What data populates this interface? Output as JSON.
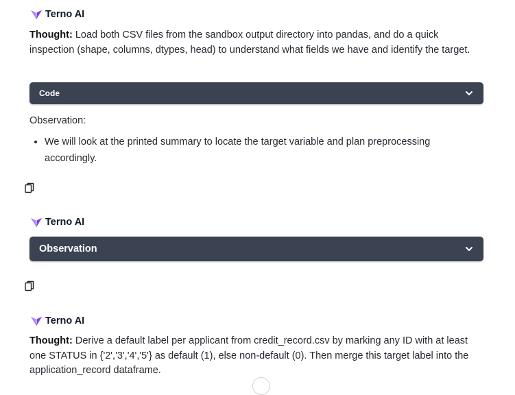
{
  "colors": {
    "bar_bg": "#3b4352",
    "logo": "#8b5cf6",
    "text": "#24292f"
  },
  "messages": [
    {
      "author": "Terno AI",
      "thought_label": "Thought:",
      "thought_text": "Load both CSV files from the sandbox output directory into pandas, and do a quick inspection (shape, columns, dtypes, head) to understand what fields we have and identify the target.",
      "code_label": "Code",
      "observation_label": "Observation:",
      "observation_items": [
        "We will look at the printed summary to locate the target variable and plan preprocessing accordingly."
      ]
    },
    {
      "author": "Terno AI",
      "panel_label": "Observation"
    },
    {
      "author": "Terno AI",
      "thought_label": "Thought:",
      "thought_text": "Derive a default label per applicant from credit_record.csv by marking any ID with at least one STATUS in {'2','3','4','5'} as default (1), else non-default (0). Then merge this target label into the application_record dataframe."
    }
  ],
  "icons": {
    "copy": "copy-icon",
    "expand": "chevron-down-icon",
    "logo": "terno-logo-icon"
  }
}
